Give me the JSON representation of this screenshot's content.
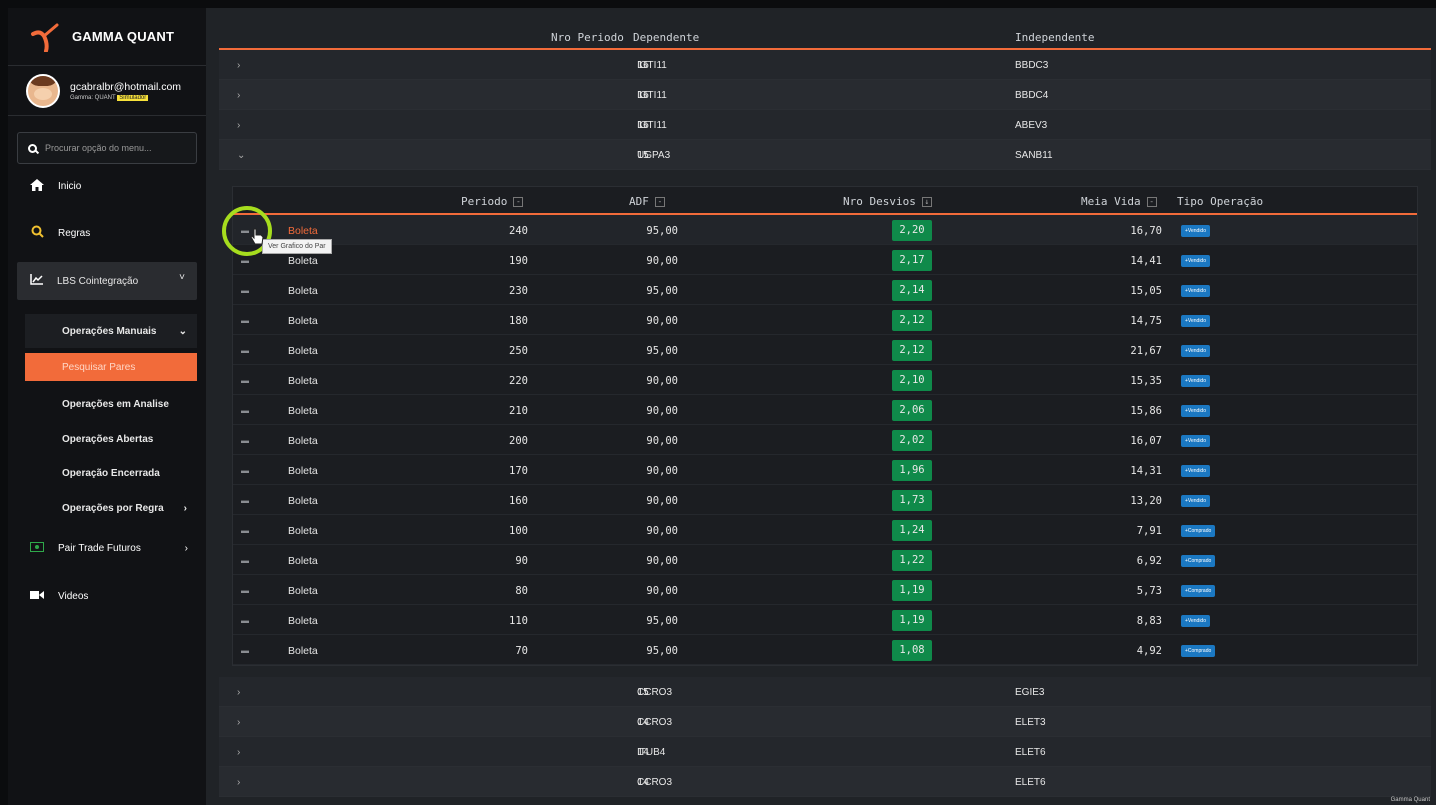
{
  "app": {
    "name": "GAMMA QUANT",
    "footer": "Gamma Quant"
  },
  "user": {
    "email": "gcabralbr@hotmail.com",
    "subtitle": "Gamma: QUANT",
    "badge": "Simulador"
  },
  "search": {
    "placeholder": "Procurar opção do menu..."
  },
  "menu": {
    "inicio": "Inicio",
    "regras": "Regras",
    "lbs": "LBS Cointegração",
    "operacoes_manuais": "Operações Manuais",
    "pesquisar_pares": "Pesquisar Pares",
    "em_analise": "Operações em Analise",
    "abertas": "Operações Abertas",
    "encerrada": "Operação Encerrada",
    "por_regra": "Operações por Regra",
    "pair_trade": "Pair Trade Futuros",
    "videos": "Videos"
  },
  "outer_headers": {
    "periodo": "Nro Periodo",
    "dependente": "Dependente",
    "independente": "Independente"
  },
  "pairs_top": [
    {
      "periodo": "16",
      "dependente": "IGTI11",
      "independente": "BBDC3"
    },
    {
      "periodo": "16",
      "dependente": "IGTI11",
      "independente": "BBDC4"
    },
    {
      "periodo": "16",
      "dependente": "IGTI11",
      "independente": "ABEV3"
    },
    {
      "periodo": "15",
      "dependente": "UGPA3",
      "independente": "SANB11"
    }
  ],
  "inner_headers": {
    "periodo": "Periodo",
    "adf": "ADF",
    "desvios": "Nro Desvios",
    "meia_vida": "Meia Vida",
    "tipo": "Tipo Operação"
  },
  "tooltip": "Ver Grafico do Par",
  "detail_rows": [
    {
      "label": "Boleta",
      "periodo": "240",
      "adf": "95,00",
      "desvios": "2,20",
      "meia_vida": "16,70",
      "tipo": "+Vendido"
    },
    {
      "label": "Boleta",
      "periodo": "190",
      "adf": "90,00",
      "desvios": "2,17",
      "meia_vida": "14,41",
      "tipo": "+Vendido"
    },
    {
      "label": "Boleta",
      "periodo": "230",
      "adf": "95,00",
      "desvios": "2,14",
      "meia_vida": "15,05",
      "tipo": "+Vendido"
    },
    {
      "label": "Boleta",
      "periodo": "180",
      "adf": "90,00",
      "desvios": "2,12",
      "meia_vida": "14,75",
      "tipo": "+Vendido"
    },
    {
      "label": "Boleta",
      "periodo": "250",
      "adf": "95,00",
      "desvios": "2,12",
      "meia_vida": "21,67",
      "tipo": "+Vendido"
    },
    {
      "label": "Boleta",
      "periodo": "220",
      "adf": "90,00",
      "desvios": "2,10",
      "meia_vida": "15,35",
      "tipo": "+Vendido"
    },
    {
      "label": "Boleta",
      "periodo": "210",
      "adf": "90,00",
      "desvios": "2,06",
      "meia_vida": "15,86",
      "tipo": "+Vendido"
    },
    {
      "label": "Boleta",
      "periodo": "200",
      "adf": "90,00",
      "desvios": "2,02",
      "meia_vida": "16,07",
      "tipo": "+Vendido"
    },
    {
      "label": "Boleta",
      "periodo": "170",
      "adf": "90,00",
      "desvios": "1,96",
      "meia_vida": "14,31",
      "tipo": "+Vendido"
    },
    {
      "label": "Boleta",
      "periodo": "160",
      "adf": "90,00",
      "desvios": "1,73",
      "meia_vida": "13,20",
      "tipo": "+Vendido"
    },
    {
      "label": "Boleta",
      "periodo": "100",
      "adf": "90,00",
      "desvios": "1,24",
      "meia_vida": "7,91",
      "tipo": "+Comprado"
    },
    {
      "label": "Boleta",
      "periodo": "90",
      "adf": "90,00",
      "desvios": "1,22",
      "meia_vida": "6,92",
      "tipo": "+Comprado"
    },
    {
      "label": "Boleta",
      "periodo": "80",
      "adf": "90,00",
      "desvios": "1,19",
      "meia_vida": "5,73",
      "tipo": "+Comprado"
    },
    {
      "label": "Boleta",
      "periodo": "110",
      "adf": "95,00",
      "desvios": "1,19",
      "meia_vida": "8,83",
      "tipo": "+Vendido"
    },
    {
      "label": "Boleta",
      "periodo": "70",
      "adf": "95,00",
      "desvios": "1,08",
      "meia_vida": "4,92",
      "tipo": "+Comprado"
    }
  ],
  "pairs_bottom": [
    {
      "periodo": "15",
      "dependente": "CCRO3",
      "independente": "EGIE3"
    },
    {
      "periodo": "14",
      "dependente": "CCRO3",
      "independente": "ELET3"
    },
    {
      "periodo": "14",
      "dependente": "ITUB4",
      "independente": "ELET6"
    },
    {
      "periodo": "14",
      "dependente": "CCRO3",
      "independente": "ELET6"
    }
  ],
  "colors": {
    "accent": "#f26b3a",
    "positive": "#0f8a4a",
    "badge": "#1b78c2",
    "highlight": "#a6dd1e"
  }
}
